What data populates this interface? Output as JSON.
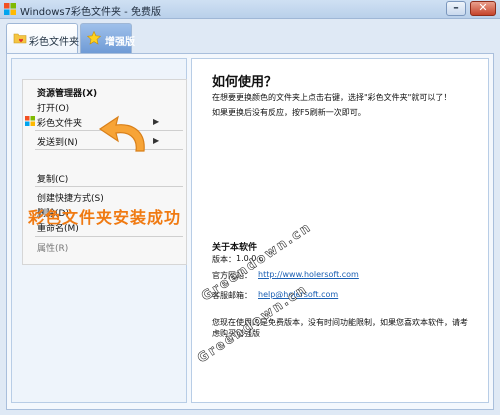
{
  "window": {
    "title": "Windows7彩色文件夹 - 免费版",
    "min_glyph": "–",
    "close_glyph": "✕"
  },
  "tabs": [
    {
      "label": "彩色文件夹",
      "icon": "folder-heart-icon",
      "active": true
    },
    {
      "label": "增强版",
      "icon": "star-icon",
      "active": false
    }
  ],
  "menu": {
    "items": [
      {
        "label": "资源管理器(X)",
        "bold": true
      },
      {
        "label": "打开(O)"
      },
      {
        "label": "彩色文件夹",
        "icon": "colorful-folder-icon",
        "arrow": "▶"
      },
      {
        "label": "发送到(N)",
        "arrow": "▶"
      },
      {
        "label": "复制(C)"
      },
      {
        "label": "创建快捷方式(S)"
      },
      {
        "label": "删除(D)"
      },
      {
        "label": "重命名(M)"
      },
      {
        "label": "属性(R)",
        "disabled": true
      }
    ]
  },
  "success_text": "彩色文件夹安装成功",
  "howto": {
    "title": "如何使用？",
    "line1": "在想要更换颜色的文件夹上点击右键，选择\"彩色文件夹\"就可以了！",
    "line2": "如果更换后没有反应，按F5刷新一次即可。"
  },
  "about": {
    "title": "关于本软件",
    "version_label": "版本：",
    "version_value": "1.0.0.0",
    "site_label": "官方网站：",
    "site_value": "http://www.holersoft.com",
    "email_label": "客服邮箱：",
    "email_value": "help@holersoft.com",
    "notice": "您现在使用的是免费版本，没有时间功能限制，如果您喜欢本软件，请考虑购买增强版"
  },
  "watermarks": [
    "Greendown.cn",
    "Greendown.cn"
  ],
  "colors": {
    "accent_orange": "#f07a12",
    "link_blue": "#1b5fb3",
    "titlebar": "#c4d8ef"
  }
}
